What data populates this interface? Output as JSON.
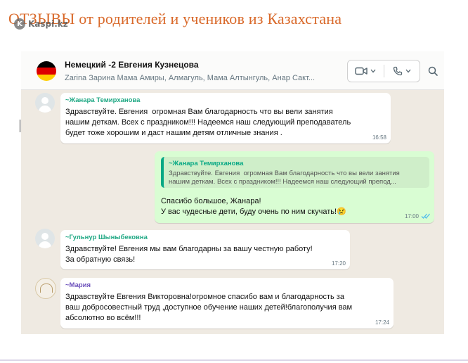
{
  "slide": {
    "title": "ОТЗЫВЫ от родителей и учеников  из Казахстана"
  },
  "watermark": {
    "text": "Kaspi.kz",
    "logo_letter": "K"
  },
  "chat": {
    "name": "Немецкий -2 Евгения Кузнецова",
    "members": "Zarina Зарина Мама Амиры, Алмагуль, Мама Алтынгуль, Анар Сакт...",
    "flag_colors": [
      "#000000",
      "#dd0000",
      "#ffce00"
    ]
  },
  "messages": [
    {
      "author": "~Жанара Темирханова",
      "author_color": "#1fa884",
      "text": "Здравствуйте. Евгения  огромная Вам благодарность что вы вели занятия\nнашим деткам. Всех с праздником!!! Надеемся наш следующий преподаватель\nбудет тоже хорошим и даст нашим детям отличные знания .",
      "time": "16:58"
    },
    {
      "quote_author": "~Жанара Темирханова",
      "quote_text": "Здравствуйте. Евгения  огромная Вам благодарность что вы вели занятия\nнашим деткам. Всех с праздником!!! Надеемся наш следующий препод...",
      "text": "Спасибо большое, Жанара!\nУ вас чудесные дети, буду очень по ним скучать!😢",
      "time": "17:00",
      "status": "read-ticks"
    },
    {
      "author": "~Гульнур Шыныбековна",
      "author_color": "#1fa884",
      "text": "Здравствуйте! Евгения мы вам благодарны за вашу честную работу!\nЗа обратную связь!",
      "time": "17:20"
    },
    {
      "author": "~Мария",
      "author_color": "#6b4fbb",
      "text": "Здравствуйте Евгения Викторовна!огромное спасибо вам и благодарность за\nваш добросовестный труд ,доступное обучение наших детей!благополучия вам\nабсолютно во всём!!!",
      "time": "17:24"
    }
  ],
  "icons": {
    "video": "video-call-icon",
    "phone": "phone-icon",
    "search": "search-icon",
    "chevron": "chevron-down-icon"
  }
}
